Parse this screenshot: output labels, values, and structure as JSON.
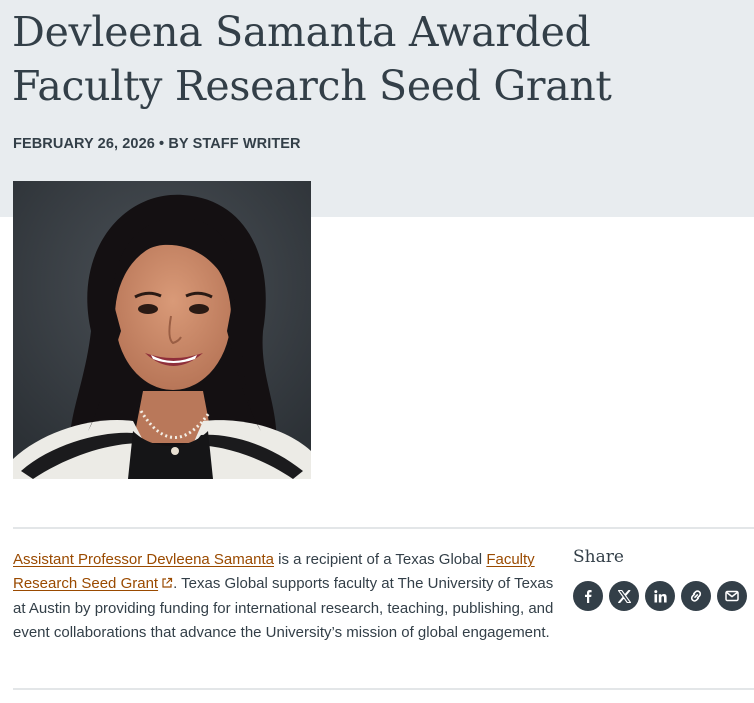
{
  "article": {
    "title": "Devleena Samanta Awarded Faculty Research Seed Grant",
    "byline": "FEBRUARY 26, 2026 • BY STAFF WRITER",
    "photo_icon": "portrait-photo",
    "body": {
      "link_person": "Assistant Professor Devleena Samanta",
      "text_1": " is a recipient of a Texas Global ",
      "link_grant": "Faculty Research Seed Grant",
      "text_2": ". Texas Global supports faculty at The University of Texas at Austin by providing funding for international research, teaching, publishing, and event collaborations that advance the University’s mission of global engagement."
    }
  },
  "share": {
    "label": "Share",
    "buttons": [
      {
        "icon": "facebook-icon"
      },
      {
        "icon": "x-icon"
      },
      {
        "icon": "linkedin-icon"
      },
      {
        "icon": "link-icon"
      },
      {
        "icon": "email-icon"
      }
    ]
  },
  "colors": {
    "header_background": "#e8ecef",
    "text": "#333f48",
    "link": "#9a4a00",
    "share_button": "#333f48",
    "divider": "#e3e6e8"
  }
}
